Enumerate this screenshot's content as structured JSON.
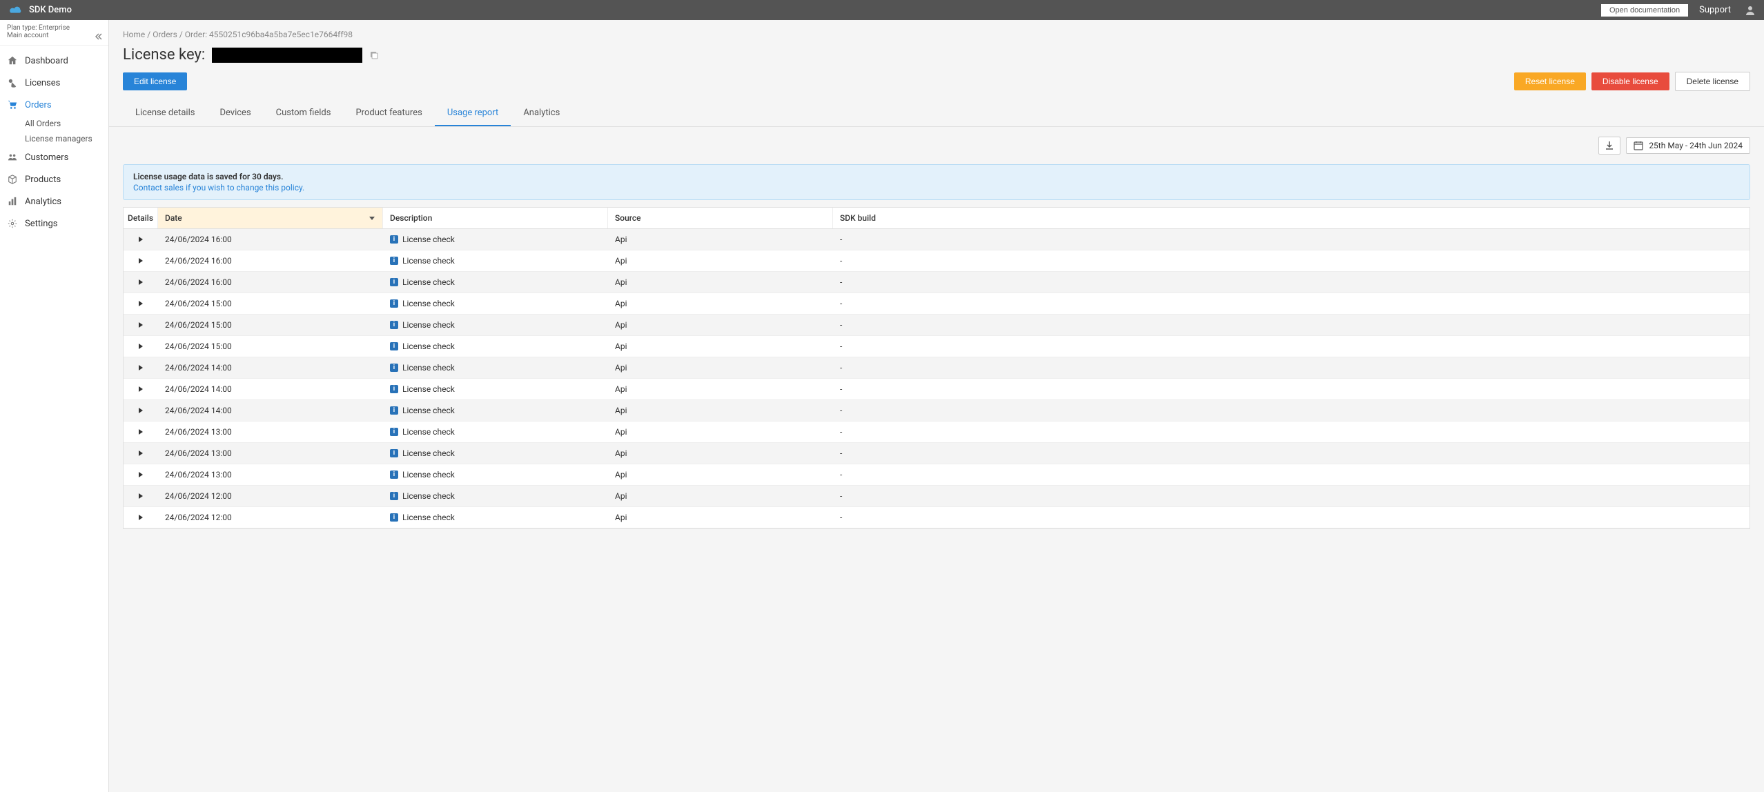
{
  "topbar": {
    "brand": "SDK Demo",
    "docs_button": "Open documentation",
    "support": "Support"
  },
  "sidebar": {
    "plan_line": "Plan type: Enterprise",
    "account_line": "Main account",
    "items": [
      {
        "label": "Dashboard"
      },
      {
        "label": "Licenses"
      },
      {
        "label": "Orders",
        "active": true
      },
      {
        "label": "Customers"
      },
      {
        "label": "Products"
      },
      {
        "label": "Analytics"
      },
      {
        "label": "Settings"
      }
    ],
    "orders_sub": [
      {
        "label": "All Orders"
      },
      {
        "label": "License managers"
      }
    ]
  },
  "breadcrumb": {
    "home": "Home",
    "orders": "Orders",
    "order": "Order: 4550251c96ba4a5ba7e5ec1e7664ff98"
  },
  "header": {
    "title_prefix": "License key: "
  },
  "actions": {
    "edit": "Edit license",
    "reset": "Reset license",
    "disable": "Disable license",
    "delete": "Delete license"
  },
  "tabs": [
    {
      "label": "License details"
    },
    {
      "label": "Devices"
    },
    {
      "label": "Custom fields"
    },
    {
      "label": "Product features"
    },
    {
      "label": "Usage report",
      "active": true
    },
    {
      "label": "Analytics"
    }
  ],
  "date_range": "25th May - 24th Jun 2024",
  "notice": {
    "title": "License usage data is saved for 30 days.",
    "link": "Contact sales if you wish to change this policy."
  },
  "table": {
    "columns": {
      "details": "Details",
      "date": "Date",
      "description": "Description",
      "source": "Source",
      "sdk": "SDK build"
    },
    "rows": [
      {
        "date": "24/06/2024 16:00",
        "description": "License check",
        "source": "Api",
        "sdk": "-"
      },
      {
        "date": "24/06/2024 16:00",
        "description": "License check",
        "source": "Api",
        "sdk": "-"
      },
      {
        "date": "24/06/2024 16:00",
        "description": "License check",
        "source": "Api",
        "sdk": "-"
      },
      {
        "date": "24/06/2024 15:00",
        "description": "License check",
        "source": "Api",
        "sdk": "-"
      },
      {
        "date": "24/06/2024 15:00",
        "description": "License check",
        "source": "Api",
        "sdk": "-"
      },
      {
        "date": "24/06/2024 15:00",
        "description": "License check",
        "source": "Api",
        "sdk": "-"
      },
      {
        "date": "24/06/2024 14:00",
        "description": "License check",
        "source": "Api",
        "sdk": "-"
      },
      {
        "date": "24/06/2024 14:00",
        "description": "License check",
        "source": "Api",
        "sdk": "-"
      },
      {
        "date": "24/06/2024 14:00",
        "description": "License check",
        "source": "Api",
        "sdk": "-"
      },
      {
        "date": "24/06/2024 13:00",
        "description": "License check",
        "source": "Api",
        "sdk": "-"
      },
      {
        "date": "24/06/2024 13:00",
        "description": "License check",
        "source": "Api",
        "sdk": "-"
      },
      {
        "date": "24/06/2024 13:00",
        "description": "License check",
        "source": "Api",
        "sdk": "-"
      },
      {
        "date": "24/06/2024 12:00",
        "description": "License check",
        "source": "Api",
        "sdk": "-"
      },
      {
        "date": "24/06/2024 12:00",
        "description": "License check",
        "source": "Api",
        "sdk": "-"
      }
    ]
  }
}
